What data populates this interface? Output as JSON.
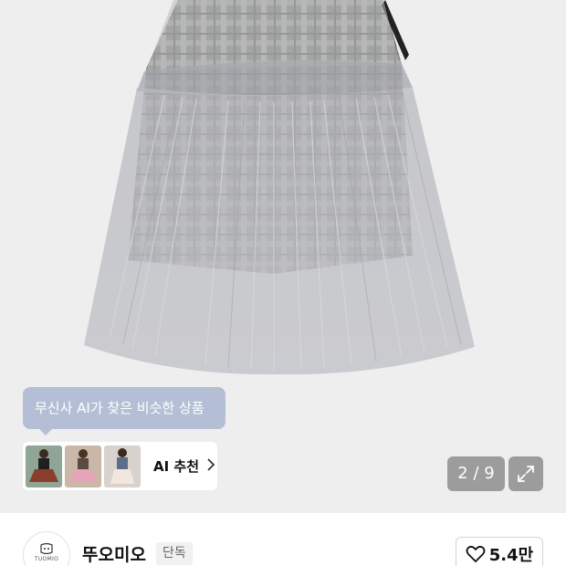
{
  "product_image": {
    "description_icon": "tulle-skirt-photo"
  },
  "ai_section": {
    "tooltip": "무신사 AI가 찾은 비슷한 상품",
    "recommend_label": "AI 추천",
    "chevron_icon": "chevron-right-icon",
    "thumbnails": [
      "similar-item-1",
      "similar-item-2",
      "similar-item-3"
    ]
  },
  "gallery": {
    "counter": "2 / 9",
    "expand_icon": "expand-icon"
  },
  "brand": {
    "name": "뚜오미오",
    "badge": "단독",
    "logo_text": "TUOMIO"
  },
  "like": {
    "icon": "heart-icon",
    "count": "5.4만"
  },
  "colors": {
    "hero_bg": "#eeeeef",
    "tooltip_bg": "#b4bfd6",
    "counter_bg": "#9c9c9c"
  }
}
